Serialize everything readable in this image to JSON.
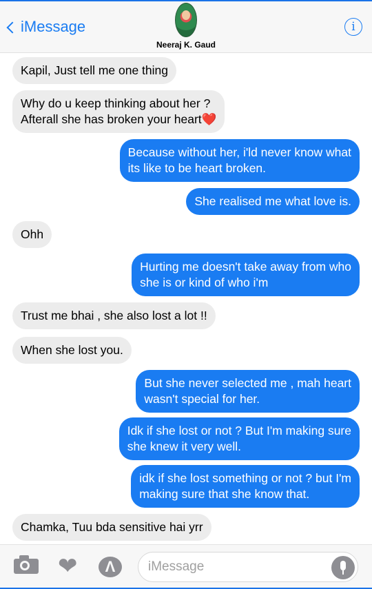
{
  "header": {
    "back_label": "iMessage",
    "contact_name": "Neeraj K. Gaud",
    "info_glyph": "i"
  },
  "messages": [
    {
      "side": "incoming",
      "text": "Kapil, Just tell me one thing"
    },
    {
      "side": "incoming",
      "text": "Why do u keep thinking about her ?\nAfterall she has broken your heart❤️"
    },
    {
      "side": "outgoing",
      "text": "Because without her, i'ld never know what\nits like to be heart broken."
    },
    {
      "side": "outgoing",
      "text": "She realised me what love is."
    },
    {
      "side": "incoming",
      "text": "Ohh"
    },
    {
      "side": "outgoing",
      "text": "Hurting me doesn't take away from who\nshe is or kind of who i'm"
    },
    {
      "side": "incoming",
      "text": "Trust me bhai ,  she also lost a lot !!"
    },
    {
      "side": "incoming",
      "text": "When she lost you."
    },
    {
      "side": "outgoing",
      "text": "But she never selected me , mah heart\nwasn't special for her."
    },
    {
      "side": "outgoing",
      "text": "Idk if she lost or not ? But I'm making sure\nshe knew it very well."
    },
    {
      "side": "outgoing",
      "text": "idk if she lost something or not ? but I'm\nmaking sure that she know that."
    },
    {
      "side": "incoming",
      "text": "Chamka, Tuu bda sensitive hai yrr"
    }
  ],
  "composer": {
    "placeholder": "iMessage",
    "icons": [
      "camera-icon",
      "digital-touch-heart-icon",
      "app-store-icon",
      "microphone-icon"
    ]
  },
  "colors": {
    "accent": "#1a7cf2",
    "incoming_bubble": "#ececec",
    "outgoing_bubble": "#1a7cf2"
  }
}
